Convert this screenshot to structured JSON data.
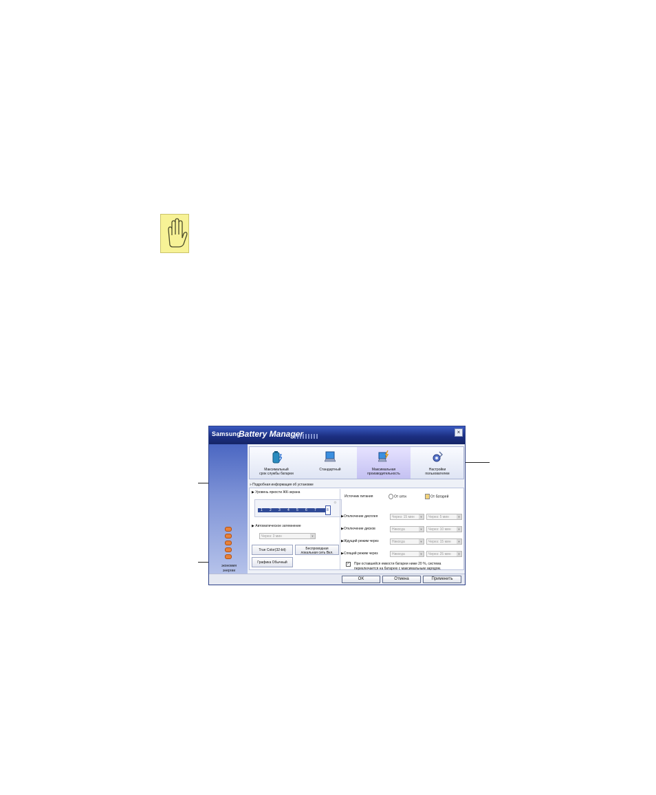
{
  "window": {
    "brand": "Samsung",
    "product": "Battery Manager",
    "close_glyph": "×"
  },
  "modes": [
    {
      "label_line1": "Максимальный",
      "label_line2": "срок службы батареи",
      "icon": "battery-icon"
    },
    {
      "label_line1": "Стандартный",
      "label_line2": "",
      "icon": "laptop-icon"
    },
    {
      "label_line1": "Максимальная",
      "label_line2": "производительность",
      "icon": "laptop-lightning-icon"
    },
    {
      "label_line1": "Настройки",
      "label_line2": "пользователем",
      "icon": "gear-wrench-icon"
    }
  ],
  "active_mode_index": 2,
  "detail_link": "Подробная информация об установке",
  "left_panel": {
    "label_line1": "экономия",
    "label_line2": "энергии"
  },
  "brightness": {
    "label": "Уровень яркости ЖК-экрана",
    "ticks": [
      "1",
      "2",
      "3",
      "4",
      "5",
      "6",
      "7",
      "8"
    ],
    "selected": "8"
  },
  "auto_dim": {
    "label": "Автоматическое затемнение",
    "value": "Через: 3 мин"
  },
  "buttons": {
    "true_color": "True Color(32-bit)",
    "wireless_line1": "Беспроводная",
    "wireless_line2": "локальная сеть Вкл.",
    "graphics": "Графика Обычный"
  },
  "power_source": {
    "label": "Источник питания",
    "ac": "От сети",
    "battery": "От батарей"
  },
  "settings": [
    {
      "label": "Отключение дисплея",
      "ac": "Через: 15 мин",
      "battery": "Через: 5 мин"
    },
    {
      "label": "Отключение дисков",
      "ac": "Никогда",
      "battery": "Через: 10 мин"
    },
    {
      "label": "Ждущий режим через",
      "ac": "Никогда",
      "battery": "Через: 15 мин"
    },
    {
      "label": "Спящий режим через",
      "ac": "Никогда",
      "battery": "Через: 25 мин"
    }
  ],
  "notice": {
    "line1": "При оставшейся емкости батареи ниже 20 %, система",
    "line2": "переключается на батарею с максимальным зарядом.",
    "checked": true
  },
  "footer": {
    "ok": "OK",
    "cancel": "Отмена",
    "apply": "Применить"
  },
  "colors": {
    "title_bar": "#1c2f82",
    "caution_bg": "#f7f296",
    "eco_dots": "#e7813a"
  }
}
